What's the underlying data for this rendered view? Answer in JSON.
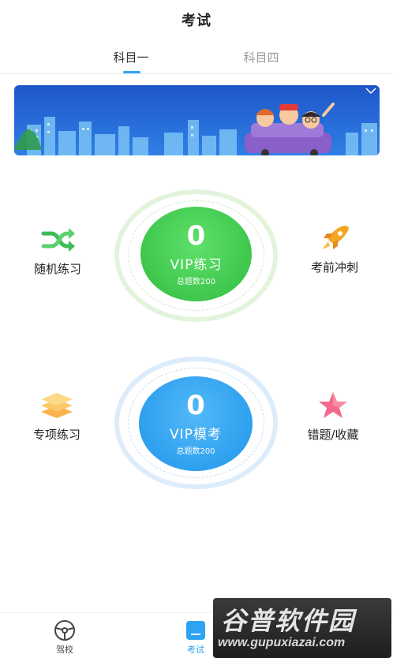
{
  "header": {
    "title": "考试"
  },
  "tabs": [
    {
      "label": "科目一",
      "active": true
    },
    {
      "label": "科目四",
      "active": false
    }
  ],
  "colors": {
    "accent": "#2ea3f2",
    "green": "#3fc74d",
    "blue": "#2ea0ef"
  },
  "practice": {
    "count": "0",
    "label": "VIP练习",
    "total": "总题数200"
  },
  "exam": {
    "count": "0",
    "label": "VIP模考",
    "total": "总题数200"
  },
  "side_items": {
    "random": {
      "label": "随机练习",
      "icon": "shuffle-icon"
    },
    "sprint": {
      "label": "考前冲刺",
      "icon": "rocket-icon"
    },
    "special": {
      "label": "专项练习",
      "icon": "layers-icon"
    },
    "wrong": {
      "label": "错题/收藏",
      "icon": "star-icon"
    }
  },
  "bottom_nav": {
    "school": {
      "label": "驾校",
      "icon": "steering-wheel-icon"
    },
    "exam": {
      "label": "考试",
      "icon": "exam-icon"
    }
  },
  "watermark": {
    "title": "谷普软件园",
    "url": "www.gupuxiazai.com"
  }
}
